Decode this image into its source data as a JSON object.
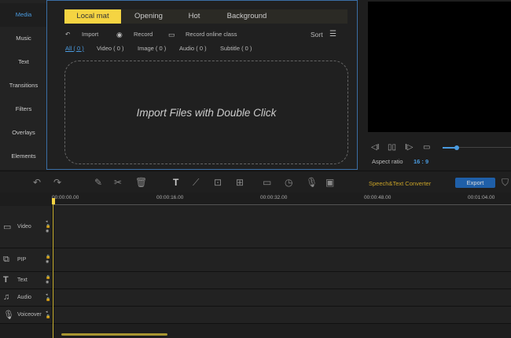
{
  "sidebar": {
    "items": [
      "Media",
      "Music",
      "Text",
      "Transitions",
      "Filters",
      "Overlays",
      "Elements"
    ]
  },
  "tabs": [
    "Local mat",
    "Opening",
    "Hot",
    "Background"
  ],
  "actions": {
    "import": "Import",
    "record": "Record",
    "record_online": "Record online class",
    "sort": "Sort"
  },
  "filters": [
    "All ( 0 )",
    "Video ( 0 )",
    "Image ( 0 )",
    "Audio ( 0 )",
    "Subtitle ( 0 )"
  ],
  "dropzone": "Import Files with Double Click",
  "preview": {
    "aspect_label": "Aspect ratio",
    "aspect_value": "16 : 9",
    "progress": 0.12
  },
  "toolbar": {
    "speech": "Speech&Text Converter",
    "export": "Export"
  },
  "ruler": [
    "00:00:00.00",
    "00:00:16.00",
    "00:00:32.00",
    "00:00:48.00",
    "00:01:04.00"
  ],
  "tracks": [
    "Video",
    "PIP",
    "Text",
    "Audio",
    "Voiceover"
  ],
  "colors": {
    "accent": "#f5d442",
    "blue": "#4a9be0",
    "export": "#1f5fa8"
  }
}
